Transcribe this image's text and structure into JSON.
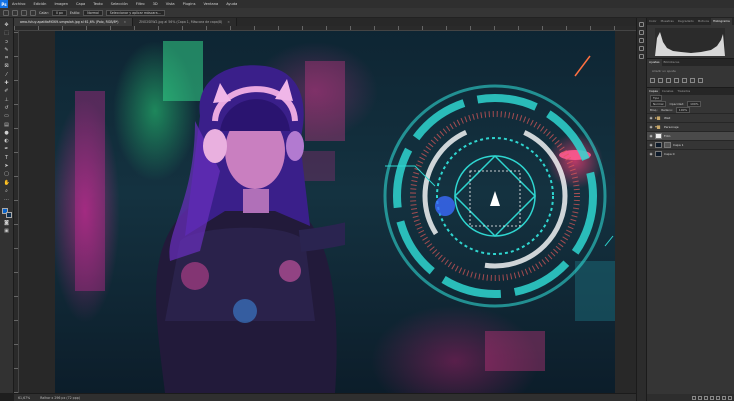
{
  "app": {
    "logo": "Ps",
    "menu": [
      "Archivo",
      "Edición",
      "Imagen",
      "Capa",
      "Texto",
      "Selección",
      "Filtro",
      "3D",
      "Vista",
      "Plugins",
      "Ventana",
      "Ayuda"
    ]
  },
  "options": {
    "feather_label": "Calar:",
    "feather_value": "0 px",
    "style_label": "Estilo:",
    "style_value": "Normal",
    "button": "Seleccionar y aplicar máscara..."
  },
  "tabs": [
    {
      "label": "ama-futuy-apatitaMOK9.umgwlah.jpg al 61,6% (Polo, RGB/8*)",
      "active": true
    },
    {
      "label": "ZNO2SEW2.jpg al 56% (Capa 1, Máscara de capa/8)",
      "active": false
    }
  ],
  "status": {
    "zoom": "61,67%",
    "doc": "Ralhor x 296 px (72 ppp)"
  },
  "panels": {
    "top_tabs": [
      "Color",
      "Muestras",
      "Degradado",
      "Motivos",
      "Histograma"
    ],
    "active_top": "Histograma",
    "adjust_tabs": [
      "Ajustes",
      "Bibliotecas"
    ],
    "adjust_hint": "Añadir un ajuste",
    "layer_tabs": [
      "Capas",
      "Canales",
      "Trazados"
    ],
    "kind": "Tipo",
    "blend": "Normal",
    "opacity_label": "Opacidad:",
    "opacity": "100%",
    "lock_label": "Bloq.:",
    "fill_label": "Relleno:",
    "fill": "100%",
    "layers": [
      {
        "name": "Wall",
        "type": "folder",
        "selected": false
      },
      {
        "name": "Personaje",
        "type": "folder",
        "selected": false
      },
      {
        "name": "Foto",
        "type": "white",
        "selected": true
      },
      {
        "name": "Capa 1",
        "type": "mask",
        "selected": false
      },
      {
        "name": "Capa 0",
        "type": "dark",
        "selected": false
      }
    ]
  },
  "colors": {
    "accent": "#1473e6",
    "foreground": "#0a63c8",
    "hud": "#2fd6d0"
  }
}
